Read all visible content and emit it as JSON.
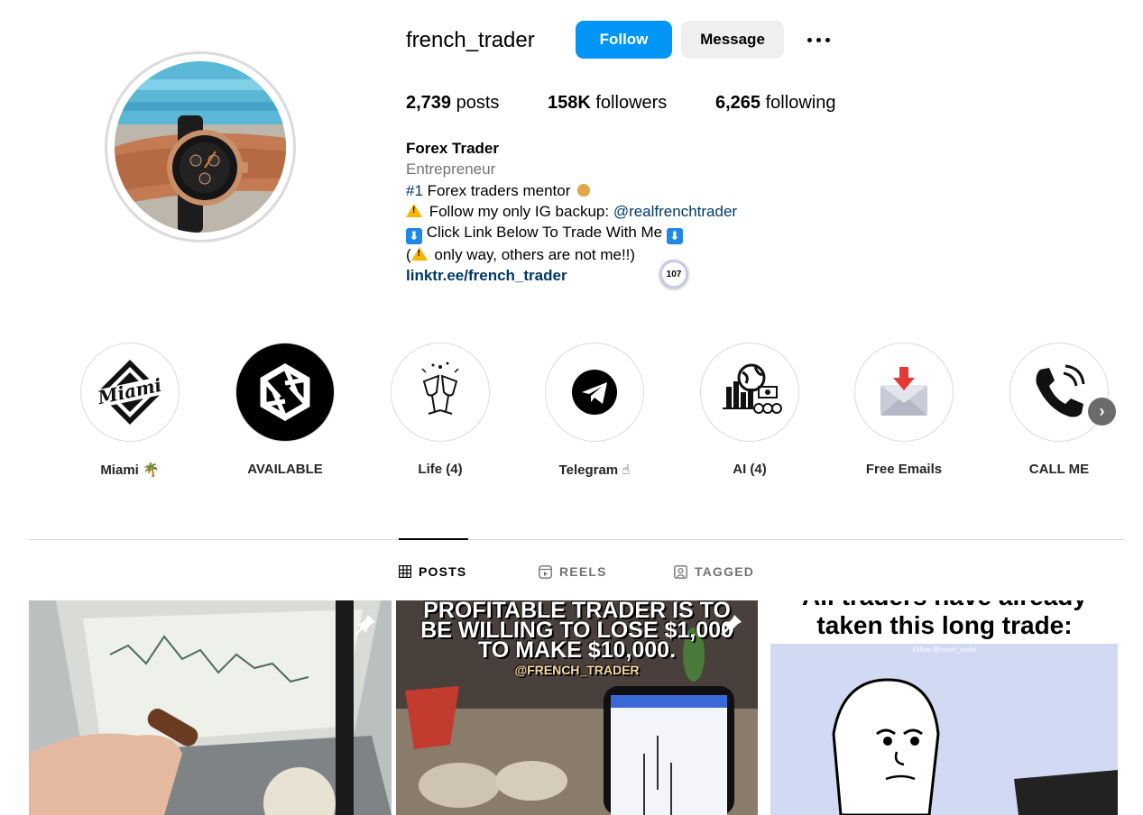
{
  "profile": {
    "username": "french_trader",
    "follow_label": "Follow",
    "message_label": "Message",
    "stats": {
      "posts_count": "2,739",
      "posts_label": "posts",
      "followers_count": "158K",
      "followers_label": "followers",
      "following_count": "6,265",
      "following_label": "following"
    },
    "bio": {
      "name": "Forex Trader",
      "category": "Entrepreneur",
      "line1_tag": "#1",
      "line1_text": " Forex traders mentor ",
      "line2_text": " Follow my only IG backup: ",
      "line2_mention": "@realfrenchtrader",
      "line3_text": " Click Link Below To Trade With Me ",
      "line4_open": "(",
      "line4_text": " only way, others are not me!!)",
      "link": "linktr.ee/french_trader"
    },
    "extension_badge": "107"
  },
  "highlights": [
    {
      "label": "Miami 🌴"
    },
    {
      "label": "AVAILABLE"
    },
    {
      "label": "Life (4)"
    },
    {
      "label": "Telegram ☝"
    },
    {
      "label": "AI (4)"
    },
    {
      "label": "Free Emails"
    },
    {
      "label": "CALL ME"
    }
  ],
  "tabs": [
    {
      "label": "POSTS",
      "icon": "grid-icon"
    },
    {
      "label": "REELS",
      "icon": "reels-icon"
    },
    {
      "label": "TAGGED",
      "icon": "tagged-icon"
    }
  ],
  "posts": {
    "post2": {
      "line1": "PROFITABLE TRADER IS TO",
      "line2": "BE WILLING TO LOSE $1,000",
      "line3": "TO MAKE $10,000.",
      "handle": "@FRENCH_TRADER"
    },
    "post3": {
      "title_top": "All traders have already",
      "title": "taken this long trade:",
      "watermark": "Follow @french_trader"
    }
  },
  "colors": {
    "follow_button": "#0095f6",
    "link": "#00376b",
    "secondary_text": "#737373"
  }
}
